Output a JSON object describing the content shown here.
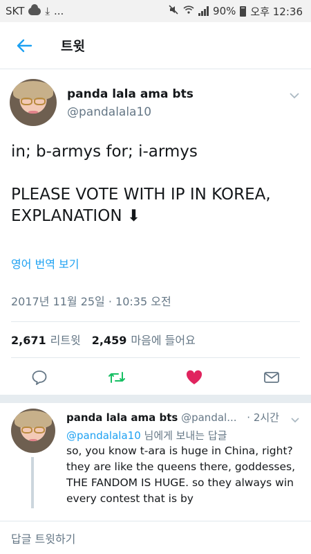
{
  "statusbar": {
    "carrier": "SKT",
    "more": "...",
    "battery": "90%",
    "time": "오후 12:36"
  },
  "header": {
    "title": "트윗"
  },
  "tweet": {
    "name": "panda lala ama bts",
    "handle": "@pandalala10",
    "text": "in; b-armys for; i-armys\n\nPLEASE VOTE WITH IP IN KOREA, EXPLANATION ⬇",
    "translate": "영어 번역 보기",
    "timestamp": "2017년 11월 25일 · 10:35 오전",
    "retweet_count": "2,671",
    "retweet_label": "리트윗",
    "like_count": "2,459",
    "like_label": "마음에 들어요"
  },
  "reply": {
    "name": "panda lala ama bts",
    "handle": "@pandal...",
    "time": "· 2시간",
    "to_mention": "@pandalala10",
    "to_suffix": " 님에게 보내는 답글",
    "text": "so, you know t-ara is huge in China, right? they are like the queens there, goddesses, THE FANDOM IS HUGE. so they always win every contest that is by"
  },
  "reply_bar": {
    "label": "답글 트윗하기"
  },
  "colors": {
    "accent": "#1da1f2",
    "retweet": "#17bf63",
    "like": "#e0245e",
    "muted": "#657786"
  },
  "icons": [
    "back-arrow-icon",
    "chevron-down-icon",
    "reply-icon",
    "retweet-icon",
    "heart-icon",
    "mail-icon"
  ]
}
